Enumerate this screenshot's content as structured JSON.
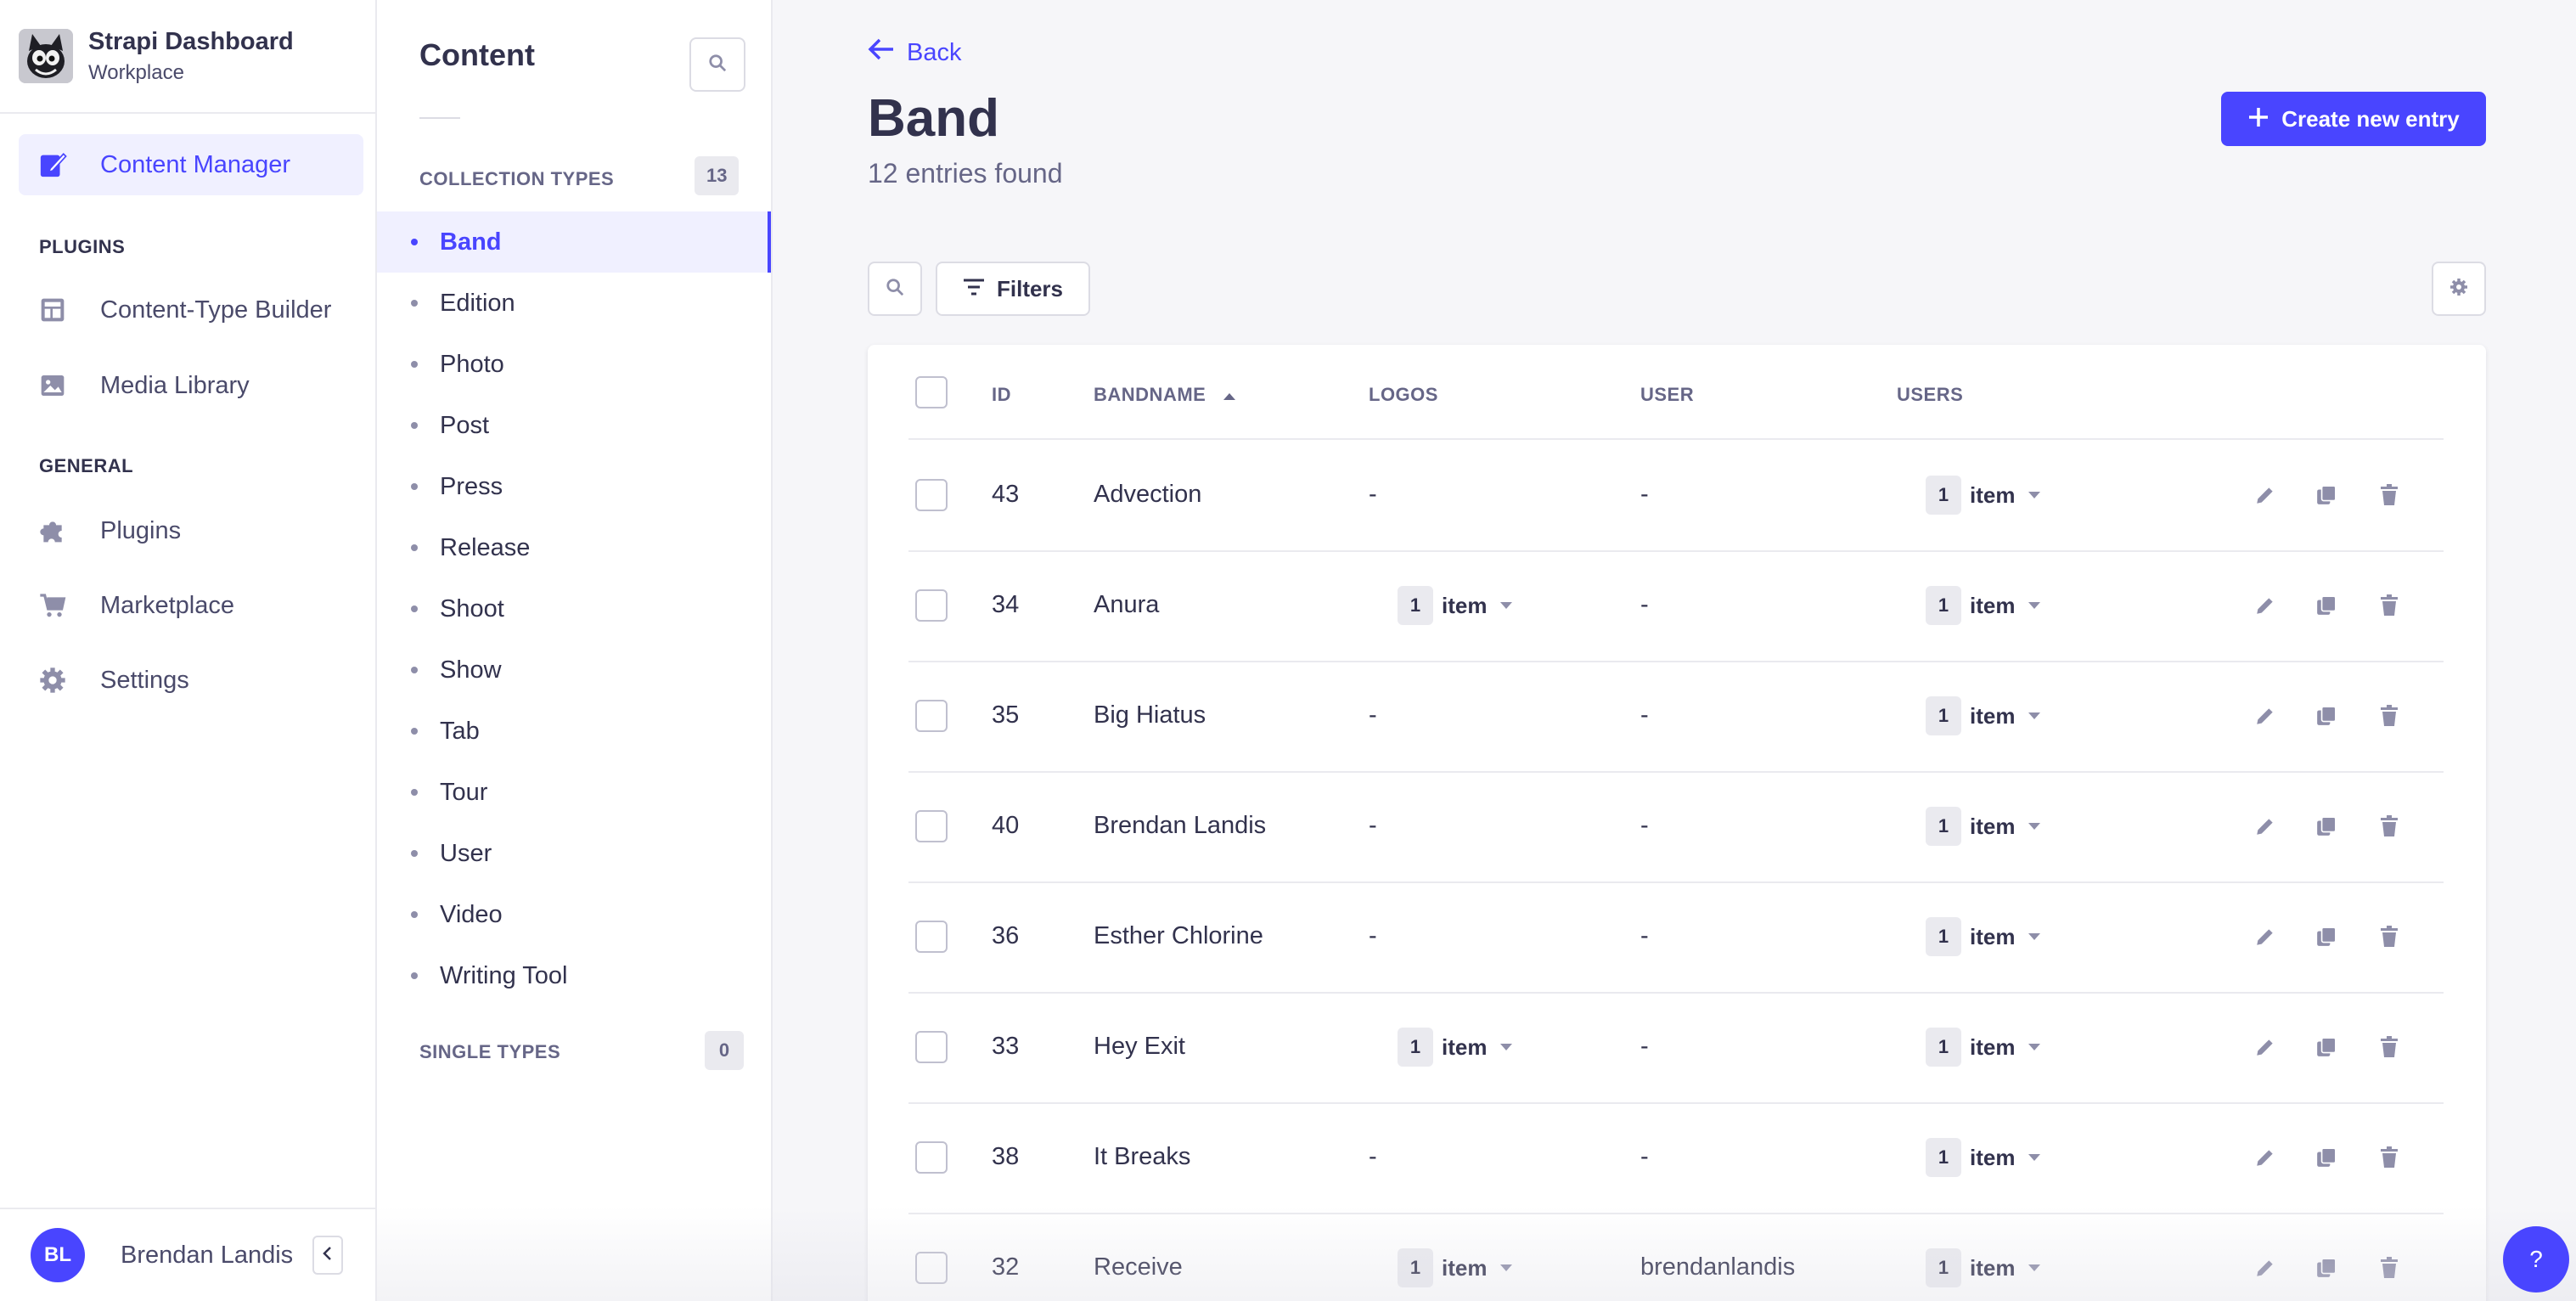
{
  "brand": {
    "title": "Strapi Dashboard",
    "subtitle": "Workplace"
  },
  "mainnav": {
    "content_manager": "Content Manager",
    "plugins_section": "PLUGINS",
    "content_type_builder": "Content-Type Builder",
    "media_library": "Media Library",
    "general_section": "GENERAL",
    "plugins": "Plugins",
    "marketplace": "Marketplace",
    "settings": "Settings"
  },
  "user": {
    "initials": "BL",
    "name": "Brendan Landis"
  },
  "subnav": {
    "title": "Content",
    "collection_types_label": "COLLECTION TYPES",
    "collection_types_count": "13",
    "single_types_label": "SINGLE TYPES",
    "single_types_count": "0",
    "items": [
      "Band",
      "Edition",
      "Photo",
      "Post",
      "Press",
      "Release",
      "Shoot",
      "Show",
      "Tab",
      "Tour",
      "User",
      "Video",
      "Writing Tool"
    ]
  },
  "page": {
    "back": "Back",
    "title": "Band",
    "subtitle": "12 entries found",
    "create_button": "Create new entry",
    "filters_button": "Filters"
  },
  "table": {
    "headers": {
      "id": "ID",
      "bandname": "BANDNAME",
      "logos": "LOGOS",
      "user": "USER",
      "users": "USERS"
    },
    "rows": [
      {
        "id": "43",
        "bandname": "Advection",
        "logos": "-",
        "logos_count": "",
        "user": "-",
        "users_count": "1"
      },
      {
        "id": "34",
        "bandname": "Anura",
        "logos": "",
        "logos_count": "1",
        "user": "-",
        "users_count": "1"
      },
      {
        "id": "35",
        "bandname": "Big Hiatus",
        "logos": "-",
        "logos_count": "",
        "user": "-",
        "users_count": "1"
      },
      {
        "id": "40",
        "bandname": "Brendan Landis",
        "logos": "-",
        "logos_count": "",
        "user": "-",
        "users_count": "1"
      },
      {
        "id": "36",
        "bandname": "Esther Chlorine",
        "logos": "-",
        "logos_count": "",
        "user": "-",
        "users_count": "1"
      },
      {
        "id": "33",
        "bandname": "Hey Exit",
        "logos": "",
        "logos_count": "1",
        "user": "-",
        "users_count": "1"
      },
      {
        "id": "38",
        "bandname": "It Breaks",
        "logos": "-",
        "logos_count": "",
        "user": "-",
        "users_count": "1"
      },
      {
        "id": "32",
        "bandname": "Receive",
        "logos": "",
        "logos_count": "1",
        "user": "brendanlandis",
        "users_count": "1"
      }
    ],
    "item_label": "item"
  },
  "help": {
    "label": "?"
  },
  "colors": {
    "accent": "#4945ff",
    "text": "#32324d",
    "muted": "#666687",
    "background": "#f6f6f9"
  }
}
